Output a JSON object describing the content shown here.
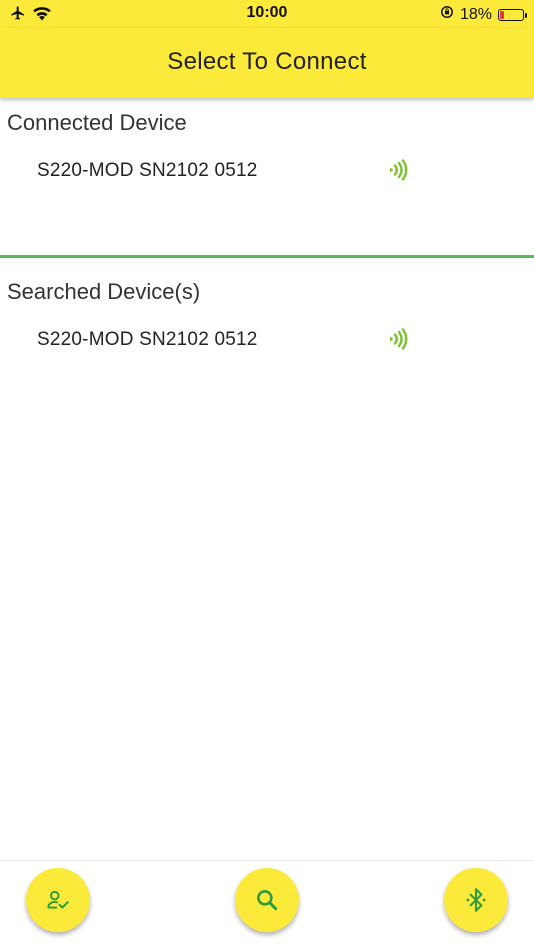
{
  "status_bar": {
    "time": "10:00",
    "battery_percent": "18%",
    "battery_level": 0.18,
    "icons": [
      "airplane-icon",
      "wifi-icon",
      "rotation-lock-icon",
      "battery-icon"
    ]
  },
  "header": {
    "title": "Select To Connect",
    "color": "#fcea3a"
  },
  "connected_section": {
    "title": "Connected Device",
    "devices": [
      {
        "name": "S220-MOD SN2102 0512",
        "icon": "signal-icon"
      }
    ]
  },
  "searched_section": {
    "title": "Searched Device(s)",
    "devices": [
      {
        "name": "S220-MOD SN2102 0512",
        "icon": "signal-icon"
      }
    ]
  },
  "bottom_actions": [
    {
      "name": "connected-devices-button",
      "icon": "user-check-icon"
    },
    {
      "name": "search-button",
      "icon": "search-icon"
    },
    {
      "name": "bluetooth-button",
      "icon": "bluetooth-icon"
    }
  ],
  "colors": {
    "accent": "#fcea3a",
    "icon_green": "#7cc22d",
    "divider": "#5cb85c",
    "fab_icon": "#2e9b3f"
  }
}
